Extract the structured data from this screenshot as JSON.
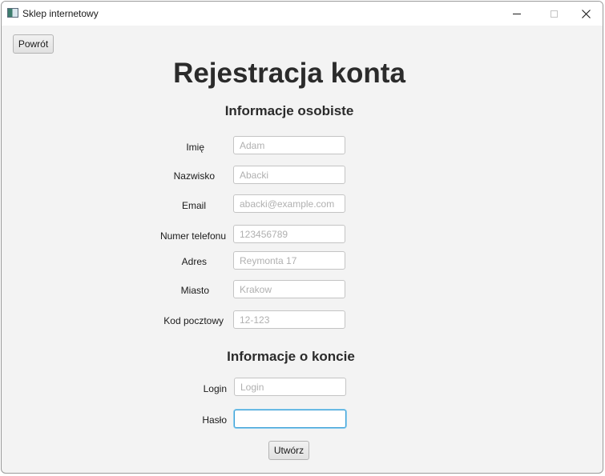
{
  "window": {
    "title": "Sklep internetowy"
  },
  "back_button": "Powrót",
  "main_title": "Rejestracja konta",
  "personal_section": {
    "title": "Informacje osobiste",
    "fields": [
      {
        "label": "Imię",
        "placeholder": "Adam",
        "value": ""
      },
      {
        "label": "Nazwisko",
        "placeholder": "Abacki",
        "value": ""
      },
      {
        "label": "Email",
        "placeholder": "abacki@example.com",
        "value": ""
      },
      {
        "label": "Numer telefonu",
        "placeholder": "123456789",
        "value": ""
      },
      {
        "label": "Adres",
        "placeholder": "Reymonta 17",
        "value": ""
      },
      {
        "label": "Miasto",
        "placeholder": "Krakow",
        "value": ""
      },
      {
        "label": "Kod pocztowy",
        "placeholder": "12-123",
        "value": ""
      }
    ]
  },
  "account_section": {
    "title": "Informacje o koncie",
    "fields": [
      {
        "label": "Login",
        "placeholder": "Login",
        "value": ""
      },
      {
        "label": "Hasło",
        "placeholder": "",
        "value": "",
        "focused": true
      }
    ]
  },
  "create_button": "Utwórz"
}
